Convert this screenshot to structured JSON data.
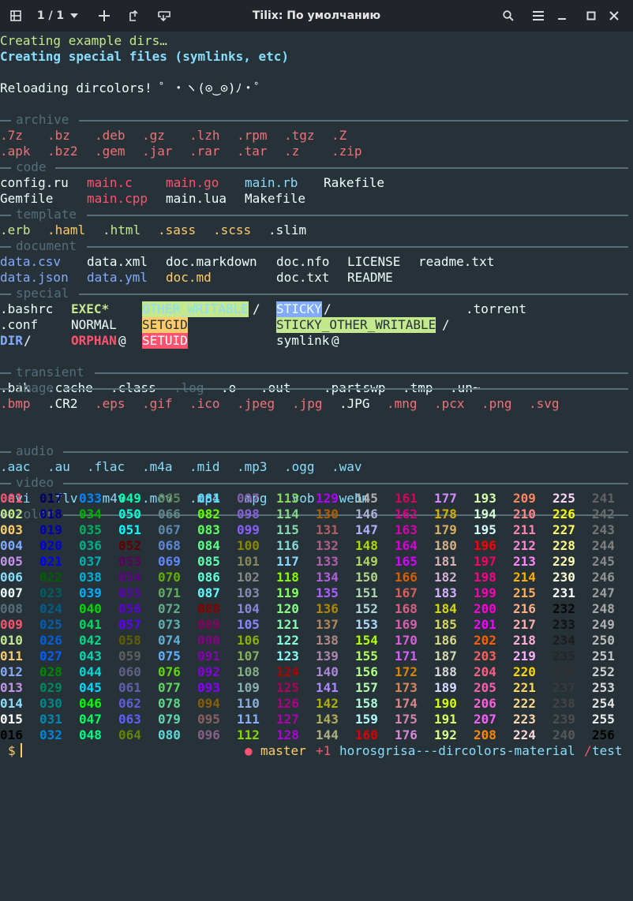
{
  "window": {
    "title": "Tilix: По умолчанию",
    "session_indicator": "1 / 1"
  },
  "lines": {
    "creating_dirs": "Creating example dirs…",
    "creating_special": "Creating special files (symlinks, etc)",
    "reloading": "Reloading dircolors! ゜・ヽ(⊙‿⊙)ﾉ・゜"
  },
  "sections": [
    {
      "id": "archive",
      "label": "archive",
      "rows": [
        [
          [
            ".7z",
            "#f07178"
          ],
          [
            ".bz",
            "#f07178"
          ],
          [
            ".deb",
            "#f07178"
          ],
          [
            ".gz",
            "#f07178"
          ],
          [
            ".lzh",
            "#f07178"
          ],
          [
            ".rpm",
            "#f07178"
          ],
          [
            ".tgz",
            "#f07178"
          ],
          [
            ".Z",
            "#f07178"
          ]
        ],
        [
          [
            ".apk",
            "#f07178"
          ],
          [
            ".bz2",
            "#f07178"
          ],
          [
            ".gem",
            "#f07178"
          ],
          [
            ".jar",
            "#f07178"
          ],
          [
            ".rar",
            "#f07178"
          ],
          [
            ".tar",
            "#f07178"
          ],
          [
            ".z",
            "#f07178"
          ],
          [
            ".zip",
            "#f07178"
          ]
        ]
      ]
    },
    {
      "id": "code",
      "label": "code",
      "rows": [
        [
          [
            "config.ru",
            "#eeffff"
          ],
          [
            "main.c",
            "#ff5370"
          ],
          [
            "main.go",
            "#ff5370"
          ],
          [
            "main.rb",
            "#89ddff"
          ],
          [
            "Rakefile",
            "#eeffff"
          ]
        ],
        [
          [
            "Gemfile",
            "#eeffff"
          ],
          [
            "main.cpp",
            "#ff5370"
          ],
          [
            "main.lua",
            "#eeffff"
          ],
          [
            "Makefile",
            "#eeffff"
          ]
        ]
      ]
    },
    {
      "id": "template",
      "label": "template",
      "rows": [
        [
          [
            ".erb",
            "#c3e88d"
          ],
          [
            ".haml",
            "#ffcb6b"
          ],
          [
            ".html",
            "#c3e88d"
          ],
          [
            ".sass",
            "#ffcb6b"
          ],
          [
            ".scss",
            "#ffcb6b"
          ],
          [
            ".slim",
            "#eeffff"
          ]
        ]
      ]
    },
    {
      "id": "document",
      "label": "document",
      "rows": [
        [
          [
            "data.csv",
            "#82aaff"
          ],
          [
            "data.xml",
            "#eeffff"
          ],
          [
            "doc.markdown",
            "#eeffff"
          ],
          [
            "doc.nfo",
            "#eeffff"
          ],
          [
            "LICENSE",
            "#eeffff"
          ],
          [
            "readme.txt",
            "#eeffff"
          ]
        ],
        [
          [
            "data.json",
            "#82aaff"
          ],
          [
            "data.yml",
            "#82aaff"
          ],
          [
            "doc.md",
            "#ffcb6b"
          ],
          [
            "doc.txt",
            "#eeffff"
          ],
          [
            "README",
            "#eeffff"
          ]
        ]
      ]
    },
    {
      "id": "special",
      "label": "special",
      "rows": [
        [
          [
            ".bashrc",
            "#eeffff"
          ],
          [
            "EXEC*",
            "#c3e88d"
          ],
          [
            "OTHER_WRITABLE",
            "#89ddff",
            "#c3e88d"
          ],
          [
            "/",
            "#eeffff"
          ],
          [
            "STICKY",
            "#eeffff",
            "#82aaff"
          ],
          [
            "/",
            "#eeffff"
          ],
          [
            ".torrent",
            "#eeffff"
          ]
        ],
        [
          [
            ".conf",
            "#eeffff"
          ],
          [
            "NORMAL",
            "#eeffff"
          ],
          [
            "SETGID",
            "#263238",
            "#ffcb6b"
          ],
          [
            "STICKY_OTHER_WRITABLE",
            "#263238",
            "#c3e88d"
          ],
          [
            "/",
            "#eeffff"
          ]
        ],
        [
          [
            "DIR",
            "#82aaff"
          ],
          [
            "/",
            "#eeffff"
          ],
          [
            "ORPHAN",
            "#ff5370"
          ],
          [
            "@",
            "#eeffff"
          ],
          [
            "SETUID",
            "#eeffff",
            "#ff5370"
          ],
          [
            "symlink",
            "#eeffff"
          ],
          [
            "@",
            "#eeffff"
          ]
        ]
      ]
    },
    {
      "id": "transient",
      "label": "transient",
      "rows": [
        [
          [
            ".bak",
            "#eeffff"
          ],
          [
            ".cache",
            "#eeffff"
          ],
          [
            ".class",
            "#eeffff"
          ],
          [
            ".log",
            "#546e7a"
          ],
          [
            ".o",
            "#eeffff"
          ],
          [
            ".out",
            "#eeffff"
          ],
          [
            ".part",
            "#eeffff"
          ],
          [
            ".swp",
            "#eeffff"
          ],
          [
            ".tmp",
            "#eeffff"
          ],
          [
            ".un~",
            "#eeffff"
          ]
        ]
      ]
    },
    {
      "id": "image",
      "label": "image",
      "rows": [
        [
          [
            ".bmp",
            "#f07178"
          ],
          [
            ".CR2",
            "#eeffff"
          ],
          [
            ".eps",
            "#f07178"
          ],
          [
            ".gif",
            "#f07178"
          ],
          [
            ".ico",
            "#f07178"
          ],
          [
            ".jpeg",
            "#f07178"
          ],
          [
            ".jpg",
            "#f07178"
          ],
          [
            ".JPG",
            "#eeffff"
          ],
          [
            ".mng",
            "#f07178"
          ],
          [
            ".pcx",
            "#f07178"
          ],
          [
            ".png",
            "#f07178"
          ],
          [
            ".svg",
            "#f07178"
          ]
        ]
      ]
    },
    {
      "id": "audio",
      "label": "audio",
      "rows": [
        [
          [
            ".aac",
            "#89ddff"
          ],
          [
            ".au",
            "#89ddff"
          ],
          [
            ".flac",
            "#89ddff"
          ],
          [
            ".m4a",
            "#89ddff"
          ],
          [
            ".mid",
            "#89ddff"
          ],
          [
            ".mp3",
            "#89ddff"
          ],
          [
            ".ogg",
            "#89ddff"
          ],
          [
            ".wav",
            "#89ddff"
          ]
        ]
      ]
    },
    {
      "id": "video",
      "label": "video",
      "rows": [
        [
          [
            ".avi",
            "#89ddff"
          ],
          [
            ".flv",
            "#89ddff"
          ],
          [
            ".m4v",
            "#89ddff"
          ],
          [
            ".mov",
            "#89ddff"
          ],
          [
            ".mp4",
            "#89ddff"
          ],
          [
            ".mpg",
            "#89ddff"
          ],
          [
            ".vob",
            "#89ddff"
          ],
          [
            ".webm",
            "#89ddff"
          ]
        ]
      ]
    },
    {
      "id": "color",
      "label": "color",
      "rows": []
    }
  ],
  "color_grid": {
    "rows": [
      [
        "001",
        "017",
        "033",
        "049",
        "065",
        "081",
        "097",
        "113",
        "129",
        "145",
        "161",
        "177",
        "193",
        "209",
        "225",
        "241"
      ],
      [
        "002",
        "018",
        "034",
        "050",
        "066",
        "082",
        "098",
        "114",
        "130",
        "146",
        "162",
        "178",
        "194",
        "210",
        "226",
        "242"
      ],
      [
        "003",
        "019",
        "035",
        "051",
        "067",
        "083",
        "099",
        "115",
        "131",
        "147",
        "163",
        "179",
        "195",
        "211",
        "227",
        "243"
      ],
      [
        "004",
        "020",
        "036",
        "052",
        "068",
        "084",
        "100",
        "116",
        "132",
        "148",
        "164",
        "180",
        "196",
        "212",
        "228",
        "244"
      ],
      [
        "005",
        "021",
        "037",
        "053",
        "069",
        "085",
        "101",
        "117",
        "133",
        "149",
        "165",
        "181",
        "197",
        "213",
        "229",
        "245"
      ],
      [
        "006",
        "022",
        "038",
        "054",
        "070",
        "086",
        "102",
        "118",
        "134",
        "150",
        "166",
        "182",
        "198",
        "214",
        "230",
        "246"
      ],
      [
        "007",
        "023",
        "039",
        "055",
        "071",
        "087",
        "103",
        "119",
        "135",
        "151",
        "167",
        "183",
        "199",
        "215",
        "231",
        "247"
      ],
      [
        "008",
        "024",
        "040",
        "056",
        "072",
        "088",
        "104",
        "120",
        "136",
        "152",
        "168",
        "184",
        "200",
        "216",
        "232",
        "248"
      ],
      [
        "009",
        "025",
        "041",
        "057",
        "073",
        "089",
        "105",
        "121",
        "137",
        "153",
        "169",
        "185",
        "201",
        "217",
        "233",
        "249"
      ],
      [
        "010",
        "026",
        "042",
        "058",
        "074",
        "090",
        "106",
        "122",
        "138",
        "154",
        "170",
        "186",
        "202",
        "218",
        "234",
        "250"
      ],
      [
        "011",
        "027",
        "043",
        "059",
        "075",
        "091",
        "107",
        "123",
        "139",
        "155",
        "171",
        "187",
        "203",
        "219",
        "235",
        "251"
      ],
      [
        "012",
        "028",
        "044",
        "060",
        "076",
        "092",
        "108",
        "124",
        "140",
        "156",
        "172",
        "188",
        "204",
        "220",
        "236",
        "252"
      ],
      [
        "013",
        "029",
        "045",
        "061",
        "077",
        "093",
        "109",
        "125",
        "141",
        "157",
        "173",
        "189",
        "205",
        "221",
        "237",
        "253"
      ],
      [
        "014",
        "030",
        "046",
        "062",
        "078",
        "094",
        "110",
        "126",
        "142",
        "158",
        "174",
        "190",
        "206",
        "222",
        "238",
        "254"
      ],
      [
        "015",
        "031",
        "047",
        "063",
        "079",
        "095",
        "111",
        "127",
        "143",
        "159",
        "175",
        "191",
        "207",
        "223",
        "239",
        "255"
      ],
      [
        "016",
        "032",
        "048",
        "064",
        "080",
        "096",
        "112",
        "128",
        "144",
        "160",
        "176",
        "192",
        "208",
        "224",
        "240",
        "256"
      ]
    ],
    "palette16": [
      "#000000",
      "#ff5370",
      "#c3e88d",
      "#ffcb6b",
      "#82aaff",
      "#c792ea",
      "#89ddff",
      "#eeffff",
      "#546e7a",
      "#ff5370",
      "#c3e88d",
      "#ffcb6b",
      "#82aaff",
      "#c792ea",
      "#89ddff",
      "#ffffff"
    ]
  },
  "prompt": {
    "symbol": "$",
    "status_dot": "●",
    "branch": "master",
    "ahead": "+1",
    "path": "horosgrisa---dircolors-material",
    "path_sep": "/",
    "dir": "test"
  },
  "colors": {
    "background": "#263238",
    "foreground": "#eeffff",
    "titlebar": "#21252b",
    "comment": "#546e7a",
    "yellow": "#ffcb6b",
    "green": "#c3e88d",
    "cyan": "#89ddff",
    "blue": "#82aaff",
    "red": "#ff5370",
    "magenta": "#c792ea"
  }
}
